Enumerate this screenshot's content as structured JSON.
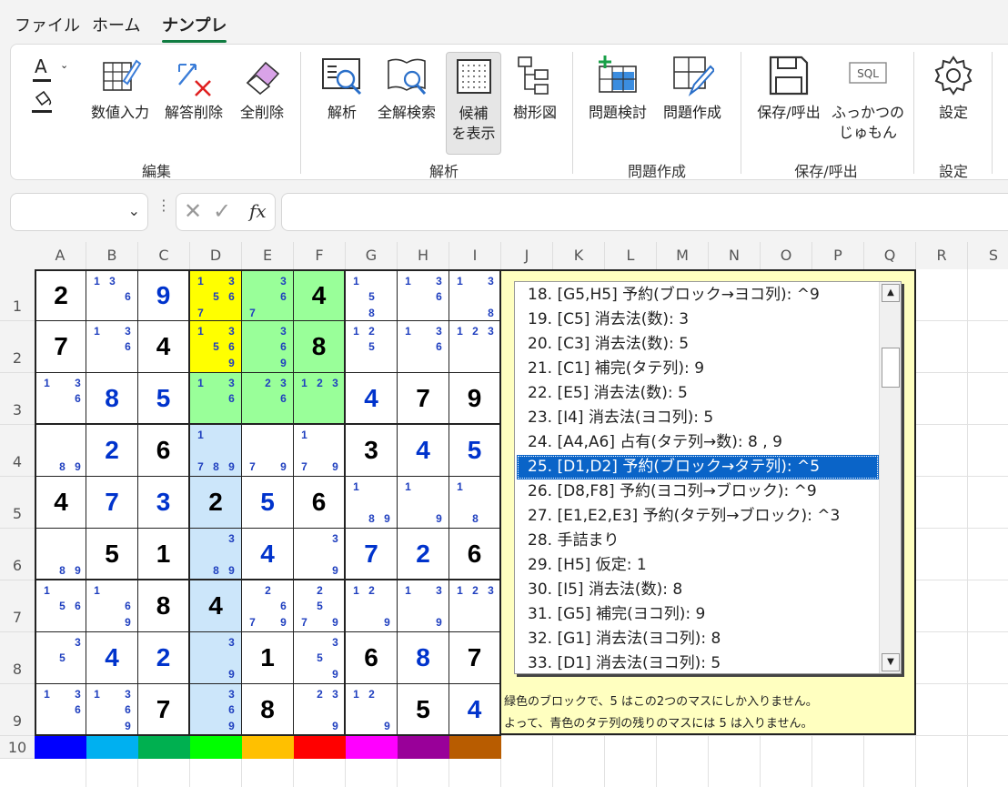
{
  "menu": {
    "file": "ファイル",
    "home": "ホーム",
    "nanpure": "ナンプレ"
  },
  "ribbon": {
    "font_color": "A",
    "buttons": [
      {
        "label": "数値入力",
        "icon": "number-input-icon"
      },
      {
        "label": "解答削除",
        "icon": "delete-answer-icon"
      },
      {
        "label": "全削除",
        "icon": "eraser-icon"
      },
      {
        "label": "解析",
        "icon": "analyze-icon"
      },
      {
        "label": "全解検索",
        "icon": "search-all-icon"
      },
      {
        "label": "候補\nを表示",
        "icon": "candidates-icon"
      },
      {
        "label": "樹形図",
        "icon": "tree-icon"
      },
      {
        "label": "問題検討",
        "icon": "problem-review-icon"
      },
      {
        "label": "問題作成",
        "icon": "problem-create-icon"
      },
      {
        "label": "保存/呼出",
        "icon": "save-icon"
      },
      {
        "label": "ふっかつの\nじゅもん",
        "icon": "sql-icon"
      },
      {
        "label": "設定",
        "icon": "gear-icon"
      }
    ],
    "groups": [
      "編集",
      "解析",
      "問題作成",
      "保存/呼出",
      "設定"
    ]
  },
  "formula": {
    "namebox": "",
    "fx": "fx",
    "content": ""
  },
  "columns": [
    "A",
    "B",
    "C",
    "D",
    "E",
    "F",
    "G",
    "H",
    "I",
    "J",
    "K",
    "L",
    "M",
    "N",
    "O",
    "P",
    "Q",
    "R",
    "S"
  ],
  "rows": [
    "1",
    "2",
    "3",
    "4",
    "5",
    "6",
    "7",
    "8",
    "9",
    "10"
  ],
  "colors": {
    "given": "#000000",
    "solved": "#0033cc",
    "candidate": "#1f3fbf",
    "yellow": "#ffff00",
    "green": "#99ff99",
    "blue": "#cce6fa",
    "selection": "#0a64c8",
    "panel": "#ffffc0"
  },
  "grid": [
    [
      {
        "v": "2",
        "c": "k"
      },
      {
        "c": "1 3 _ _ _ 6"
      },
      {
        "v": "9",
        "c": "b"
      },
      {
        "c": "1 _ 3 _ 5 6 7 _ _",
        "bg": "y"
      },
      {
        "c": "_ _ 3 _ _ 6 7 _ _",
        "bg": "g"
      },
      {
        "v": "4",
        "c": "k",
        "bg": "g"
      },
      {
        "c": "1 _ _ _ 5 _ _ 8 _"
      },
      {
        "c": "1 _ 3 _ _ 6"
      },
      {
        "c": "1 _ 3 _ _ _ _ _ 8"
      }
    ],
    [
      {
        "v": "7",
        "c": "k"
      },
      {
        "c": "1 _ 3 _ _ 6"
      },
      {
        "v": "4",
        "c": "k"
      },
      {
        "c": "1 _ 3 _ 5 6 _ _ 9",
        "bg": "y"
      },
      {
        "c": "_ _ 3 _ _ 6 _ _ 9",
        "bg": "g"
      },
      {
        "v": "8",
        "c": "k",
        "bg": "g"
      },
      {
        "c": "1 2 _ _ 5 _"
      },
      {
        "c": "1 _ 3 _ _ 6"
      },
      {
        "c": "1 2 3"
      }
    ],
    [
      {
        "c": "1 _ 3 _ _ 6"
      },
      {
        "v": "8",
        "c": "b"
      },
      {
        "v": "5",
        "c": "b"
      },
      {
        "c": "1 _ 3 _ _ 6",
        "bg": "g"
      },
      {
        "c": "_ 2 3 _ _ 6",
        "bg": "g"
      },
      {
        "c": "1 2 3",
        "bg": "g"
      },
      {
        "v": "4",
        "c": "b"
      },
      {
        "v": "7",
        "c": "k"
      },
      {
        "v": "9",
        "c": "k"
      }
    ],
    [
      {
        "c": "_ _ _ _ _ _ _ 8 9"
      },
      {
        "v": "2",
        "c": "b"
      },
      {
        "v": "6",
        "c": "k"
      },
      {
        "c": "1 _ _ _ _ _ 7 8 9",
        "bg": "l"
      },
      {
        "c": "_ _ _ _ _ _ 7 _ 9"
      },
      {
        "c": "1 _ _ _ _ _ 7 _ 9"
      },
      {
        "v": "3",
        "c": "k"
      },
      {
        "v": "4",
        "c": "b"
      },
      {
        "v": "5",
        "c": "b"
      }
    ],
    [
      {
        "v": "4",
        "c": "k"
      },
      {
        "v": "7",
        "c": "b"
      },
      {
        "v": "3",
        "c": "b"
      },
      {
        "v": "2",
        "c": "k",
        "bg": "l"
      },
      {
        "v": "5",
        "c": "b"
      },
      {
        "v": "6",
        "c": "k"
      },
      {
        "c": "1 _ _ _ _ _ _ 8 9"
      },
      {
        "c": "1 _ _ _ _ _ _ _ 9"
      },
      {
        "c": "1 _ _ _ _ _ _ 8 _"
      }
    ],
    [
      {
        "c": "_ _ _ _ _ _ _ 8 9"
      },
      {
        "v": "5",
        "c": "k"
      },
      {
        "v": "1",
        "c": "k"
      },
      {
        "c": "_ _ 3 _ _ _ _ 8 9",
        "bg": "l"
      },
      {
        "v": "4",
        "c": "b"
      },
      {
        "c": "_ _ 3 _ _ _ _ _ 9"
      },
      {
        "v": "7",
        "c": "b"
      },
      {
        "v": "2",
        "c": "b"
      },
      {
        "v": "6",
        "c": "k"
      }
    ],
    [
      {
        "c": "1 _ _ _ 5 6"
      },
      {
        "c": "1 _ _ _ _ 6 _ _ 9"
      },
      {
        "v": "8",
        "c": "k"
      },
      {
        "v": "4",
        "c": "k",
        "bg": "l"
      },
      {
        "c": "_ 2 _ _ _ 6 7 _ 9"
      },
      {
        "c": "_ 2 _ _ 5 _ 7 _ 9"
      },
      {
        "c": "1 2 _ _ _ _ _ _ 9"
      },
      {
        "c": "1 _ 3 _ _ _ _ _ 9"
      },
      {
        "c": "1 2 3"
      }
    ],
    [
      {
        "c": "_ _ 3 _ 5 _"
      },
      {
        "v": "4",
        "c": "b"
      },
      {
        "v": "2",
        "c": "b"
      },
      {
        "c": "_ _ 3 _ _ _ _ _ 9",
        "bg": "l"
      },
      {
        "v": "1",
        "c": "k"
      },
      {
        "c": "_ _ 3 _ 5 _ _ _ 9"
      },
      {
        "v": "6",
        "c": "k"
      },
      {
        "v": "8",
        "c": "b"
      },
      {
        "v": "7",
        "c": "k"
      }
    ],
    [
      {
        "c": "1 _ 3 _ _ 6"
      },
      {
        "c": "1 _ 3 _ _ 6 _ _ 9"
      },
      {
        "v": "7",
        "c": "k"
      },
      {
        "c": "_ _ 3 _ _ 6 _ _ 9",
        "bg": "l"
      },
      {
        "v": "8",
        "c": "k"
      },
      {
        "c": "_ 2 3 _ _ _ _ _ 9"
      },
      {
        "c": "1 2 _ _ _ _ _ _ 9"
      },
      {
        "v": "5",
        "c": "k"
      },
      {
        "v": "4",
        "c": "b"
      }
    ]
  ],
  "color_row": [
    "#0000ff",
    "#00b0f0",
    "#00b050",
    "#00ff00",
    "#ffc000",
    "#ff0000",
    "#ff00ff",
    "#990099",
    "#b85c00"
  ],
  "steps": [
    "18. [G5,H5] 予約(ブロック→ヨコ列): ^9",
    "19. [C5] 消去法(数): 3",
    "20. [C3] 消去法(数): 5",
    "21. [C1] 補完(タテ列): 9",
    "22. [E5] 消去法(数): 5",
    "23. [I4] 消去法(ヨコ列): 5",
    "24. [A4,A6] 占有(タテ列→数): 8 , 9",
    "25. [D1,D2] 予約(ブロック→タテ列): ^5",
    "26. [D8,F8] 予約(ヨコ列→ブロック): ^9",
    "27. [E1,E2,E3] 予約(タテ列→ブロック): ^3",
    "28. 手詰まり",
    "29. [H5] 仮定: 1",
    "30. [I5] 消去法(数): 8",
    "31. [G5] 補完(ヨコ列): 9",
    "32. [G1] 消去法(ヨコ列): 8",
    "33. [D1] 消去法(ヨコ列): 5"
  ],
  "selected_step": 7,
  "notes": [
    "緑色のブロックで、5 はこの2つのマスにしか入りません。",
    "よって、青色のタテ列の残りのマスには 5 は入りません。"
  ]
}
